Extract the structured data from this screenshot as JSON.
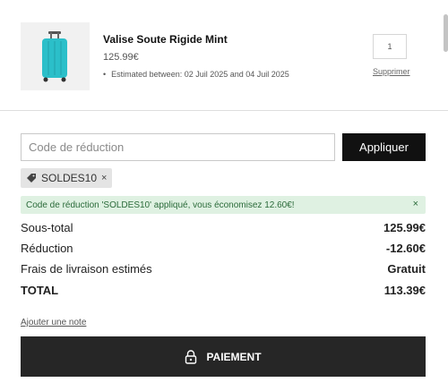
{
  "item": {
    "name": "Valise Soute Rigide Mint",
    "price": "125.99€",
    "eta": "Estimated between: 02 Juil 2025 and 04 Juil 2025",
    "quantity": "1",
    "remove_label": "Supprimer"
  },
  "discount": {
    "placeholder": "Code de réduction",
    "apply_label": "Appliquer",
    "applied_code": "SOLDES10",
    "remove_code_symbol": "×",
    "success_message": "Code de réduction 'SOLDES10' appliqué, vous économisez 12.60€!",
    "close_symbol": "×"
  },
  "summary": {
    "subtotal_label": "Sous-total",
    "subtotal_value": "125.99€",
    "discount_label": "Réduction",
    "discount_value": "-12.60€",
    "shipping_label": "Frais de livraison estimés",
    "shipping_value": "Gratuit",
    "total_label": "TOTAL",
    "total_value": "113.39€"
  },
  "note_label": "Ajouter une note",
  "checkout_label": "PAIEMENT",
  "colors": {
    "accent": "#111111",
    "checkout_bg": "#262626",
    "success_bg": "#dff1e2",
    "success_text": "#2b6b3a",
    "suitcase": "#2bbfc9"
  },
  "icons": [
    "suitcase-image",
    "tag-icon",
    "lock-icon",
    "close-icon"
  ]
}
